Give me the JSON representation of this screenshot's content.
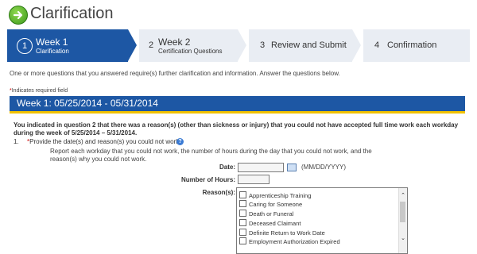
{
  "header": {
    "title": "Clarification",
    "back_icon": "green-arrow-circle-icon"
  },
  "steps": [
    {
      "number": "1",
      "title": "Week 1",
      "subtitle": "Clarification",
      "active": true
    },
    {
      "number": "2",
      "title": "Week 2",
      "subtitle": "Certification Questions",
      "active": false
    },
    {
      "number": "3",
      "title": "Review and Submit",
      "subtitle": "",
      "active": false
    },
    {
      "number": "4",
      "title": "Confirmation",
      "subtitle": "",
      "active": false
    }
  ],
  "intro": "One or more questions that you answered require(s) further clarification and information. Answer the questions below.",
  "required_note": {
    "star": "*",
    "text": "Indicates required field"
  },
  "week_bar": "Week 1: 05/25/2014 - 05/31/2014",
  "question_text": "You indicated in question 2 that there was a reason(s) (other than sickness or injury) that you could not have accepted full time work each workday during the week of 5/25/2014 – 5/31/2014.",
  "item": {
    "number": "1.",
    "star": "*",
    "label": "Provide the date(s) and reason(s) you could not work.",
    "help_icon": "question-help-icon",
    "instruction": "Report each workday that you could not work, the number of hours during the day that you could not work, and the reason(s) why you could not work."
  },
  "form": {
    "date_label": "Date:",
    "date_value": "",
    "date_hint": "(MM/DD/YYYY)",
    "calendar_icon": "calendar-icon",
    "hours_label": "Number of Hours:",
    "hours_value": "",
    "reasons_label": "Reason(s):",
    "reasons": [
      "Apprenticeship Training",
      "Caring for Someone",
      "Death or Funeral",
      "Deceased Claimant",
      "Definite Return to Work Date",
      "Employment Authorization Expired"
    ]
  },
  "colors": {
    "accent_blue": "#1d57a4",
    "week_bar_underline": "#f2c200",
    "step_inactive": "#e9edf3",
    "required_red": "#c00000"
  }
}
